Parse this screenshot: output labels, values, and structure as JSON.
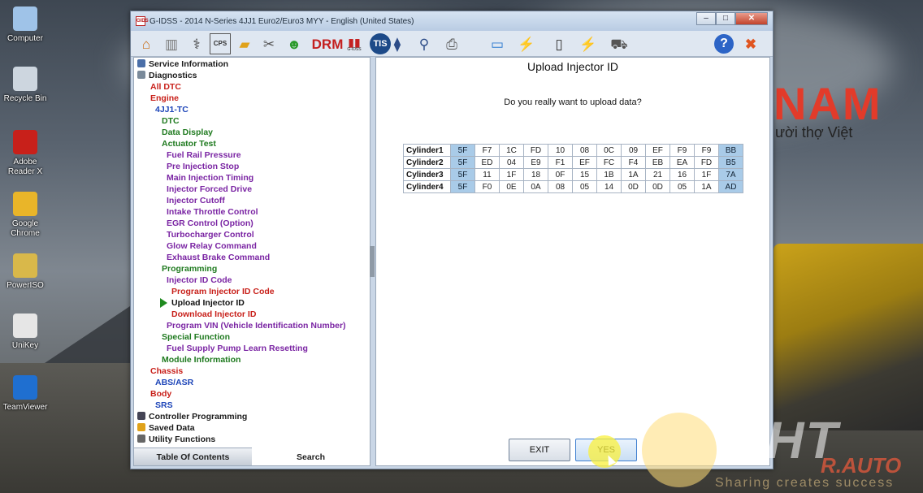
{
  "desktop": {
    "icons": [
      {
        "label": "Computer",
        "icon": "computer-icon",
        "color": "#9fc3e8"
      },
      {
        "label": "Recycle Bin",
        "icon": "recycle-bin-icon",
        "color": "#cdd6df"
      },
      {
        "label": "Adobe Reader X",
        "icon": "adobe-reader-icon",
        "color": "#c8201a"
      },
      {
        "label": "Google Chrome",
        "icon": "chrome-icon",
        "color": "#e9b529"
      },
      {
        "label": "PowerISO",
        "icon": "poweriso-icon",
        "color": "#d9b84a"
      },
      {
        "label": "UniKey",
        "icon": "unikey-icon",
        "color": "#e6e6e6"
      },
      {
        "label": "TeamViewer",
        "icon": "teamviewer-icon",
        "color": "#1f6fd0"
      }
    ],
    "brand_logo": "NAM",
    "brand_sub": "ười thợ Việt",
    "watermark": "DHT",
    "watermark_orange": "R.AUTO",
    "watermark_sub": "Sharing creates success"
  },
  "window": {
    "app_icon_text": "GIDS",
    "title": "G-IDSS - 2014 N-Series 4JJ1 Euro2/Euro3 MYY - English (United States)",
    "controls": {
      "minimize": "–",
      "maximize": "□",
      "close": "✕"
    }
  },
  "toolbar": {
    "drm_label": "DRM",
    "tis_label": "TIS",
    "gidss_label": "G-IDSS",
    "help_label": "?"
  },
  "sidebar": {
    "items": [
      {
        "label": "Service Information",
        "color": "dark",
        "indent": 0,
        "icon": "service-info-icon"
      },
      {
        "label": "Diagnostics",
        "color": "dark",
        "indent": 0,
        "icon": "diagnostics-icon"
      },
      {
        "label": "All DTC",
        "color": "red",
        "indent": 1
      },
      {
        "label": "Engine",
        "color": "red",
        "indent": 1
      },
      {
        "label": "4JJ1-TC",
        "color": "blue",
        "indent": 2
      },
      {
        "label": "DTC",
        "color": "green",
        "indent": 3
      },
      {
        "label": "Data Display",
        "color": "green",
        "indent": 3
      },
      {
        "label": "Actuator Test",
        "color": "green",
        "indent": 3
      },
      {
        "label": "Fuel Rail Pressure",
        "color": "purple",
        "indent": 4
      },
      {
        "label": "Pre Injection Stop",
        "color": "purple",
        "indent": 4
      },
      {
        "label": "Main Injection Timing",
        "color": "purple",
        "indent": 4
      },
      {
        "label": "Injector Forced Drive",
        "color": "purple",
        "indent": 4
      },
      {
        "label": "Injector Cutoff",
        "color": "purple",
        "indent": 4
      },
      {
        "label": "Intake Throttle Control",
        "color": "purple",
        "indent": 4
      },
      {
        "label": "EGR Control (Option)",
        "color": "purple",
        "indent": 4
      },
      {
        "label": "Turbocharger Control",
        "color": "purple",
        "indent": 4
      },
      {
        "label": "Glow Relay Command",
        "color": "purple",
        "indent": 4
      },
      {
        "label": "Exhaust Brake Command",
        "color": "purple",
        "indent": 4
      },
      {
        "label": "Programming",
        "color": "green",
        "indent": 3
      },
      {
        "label": "Injector ID Code",
        "color": "purple",
        "indent": 4
      },
      {
        "label": "Program Injector ID Code",
        "color": "red",
        "indent": 5
      },
      {
        "label": "Upload Injector ID",
        "color": "sel",
        "indent": 5,
        "selected": true
      },
      {
        "label": "Download Injector ID",
        "color": "red",
        "indent": 5
      },
      {
        "label": "Program VIN (Vehicle Identification Number)",
        "color": "purple",
        "indent": 4
      },
      {
        "label": "Special Function",
        "color": "green",
        "indent": 3
      },
      {
        "label": "Fuel Supply Pump Learn Resetting",
        "color": "purple",
        "indent": 4
      },
      {
        "label": "Module Information",
        "color": "green",
        "indent": 3
      },
      {
        "label": "Chassis",
        "color": "red",
        "indent": 1
      },
      {
        "label": "ABS/ASR",
        "color": "blue",
        "indent": 2
      },
      {
        "label": "Body",
        "color": "red",
        "indent": 1
      },
      {
        "label": "SRS",
        "color": "blue",
        "indent": 2
      },
      {
        "label": "Controller Programming",
        "color": "dark",
        "indent": 0,
        "icon": "controller-programming-icon"
      },
      {
        "label": "Saved Data",
        "color": "dark",
        "indent": 0,
        "icon": "folder-icon"
      },
      {
        "label": "Utility Functions",
        "color": "dark",
        "indent": 0,
        "icon": "wrench-icon"
      }
    ],
    "tabs": {
      "toc": "Table Of Contents",
      "search": "Search"
    }
  },
  "main": {
    "title": "Upload Injector ID",
    "question": "Do you really want to upload data?",
    "rows": [
      {
        "label": "Cylinder1",
        "values": [
          "5F",
          "F7",
          "1C",
          "FD",
          "10",
          "08",
          "0C",
          "09",
          "EF",
          "F9",
          "F9",
          "BB"
        ]
      },
      {
        "label": "Cylinder2",
        "values": [
          "5F",
          "ED",
          "04",
          "E9",
          "F1",
          "EF",
          "FC",
          "F4",
          "EB",
          "EA",
          "FD",
          "B5"
        ]
      },
      {
        "label": "Cylinder3",
        "values": [
          "5F",
          "11",
          "1F",
          "18",
          "0F",
          "15",
          "1B",
          "1A",
          "21",
          "16",
          "1F",
          "7A"
        ]
      },
      {
        "label": "Cylinder4",
        "values": [
          "5F",
          "F0",
          "0E",
          "0A",
          "08",
          "05",
          "14",
          "0D",
          "0D",
          "05",
          "1A",
          "AD"
        ]
      }
    ],
    "buttons": {
      "exit": "EXIT",
      "yes": "YES"
    }
  },
  "colors": {
    "highlight_cell": "#a9cbe8",
    "tree_red": "#c8201a",
    "tree_blue": "#1d45b8",
    "tree_green": "#1f7a1f",
    "tree_purple": "#7a24a3"
  }
}
